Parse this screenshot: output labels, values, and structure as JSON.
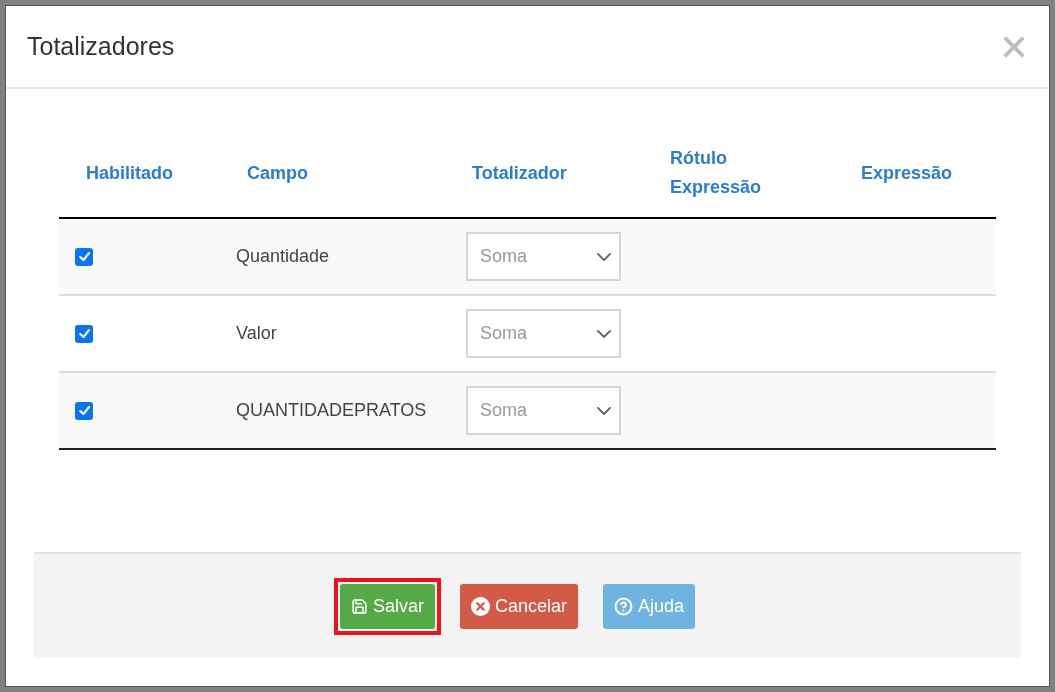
{
  "dialog": {
    "title": "Totalizadores"
  },
  "table": {
    "columns": [
      "Habilitado",
      "Campo",
      "Totalizador",
      "Rótulo Expressão",
      "Expressão"
    ],
    "rows": [
      {
        "enabled": true,
        "campo": "Quantidade",
        "totalizador": "Soma"
      },
      {
        "enabled": true,
        "campo": "Valor",
        "totalizador": "Soma"
      },
      {
        "enabled": true,
        "campo": "QUANTIDADEPRATOS",
        "totalizador": "Soma"
      }
    ]
  },
  "buttons": [
    {
      "label": "Salvar",
      "kind": "save",
      "color": "#55aa47",
      "highlighted": true
    },
    {
      "label": "Cancelar",
      "kind": "cancel",
      "color": "#d15b47",
      "highlighted": false
    },
    {
      "label": "Ajuda",
      "kind": "help",
      "color": "#6fb3e0",
      "highlighted": false
    }
  ]
}
